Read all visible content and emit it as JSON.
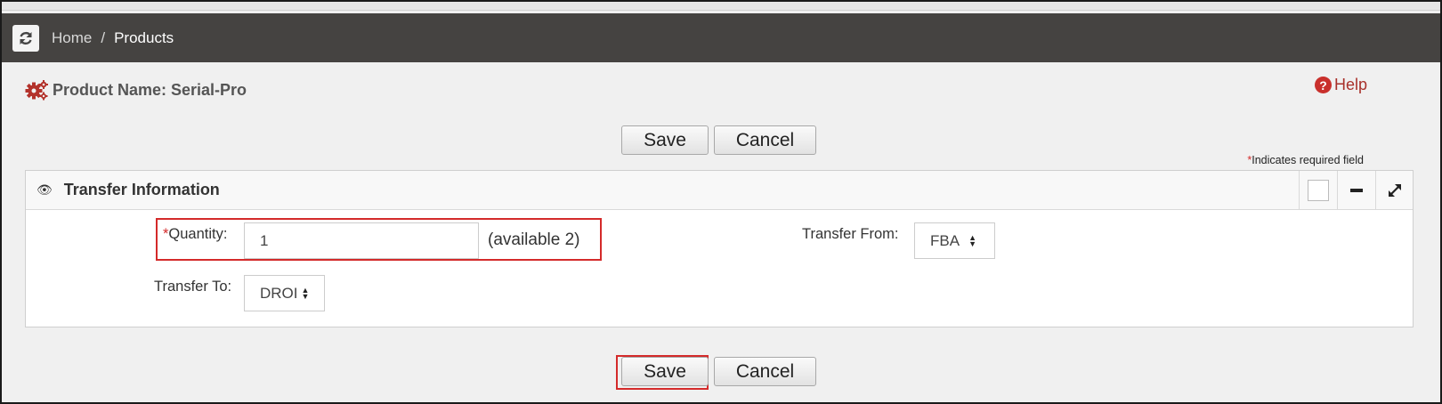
{
  "breadcrumb": {
    "home": "Home",
    "separator": "/",
    "current": "Products"
  },
  "page": {
    "title": "Product Name: Serial-Pro",
    "help": "Help"
  },
  "actions": {
    "save": "Save",
    "cancel": "Cancel"
  },
  "required_note": {
    "star": "*",
    "text": "Indicates required field"
  },
  "panel": {
    "title": "Transfer Information",
    "quantity_label": "Quantity:",
    "quantity_value": "1",
    "available_text": "(available  2)",
    "transfer_from_label": "Transfer From:",
    "transfer_from_value": "FBA",
    "transfer_to_label": "Transfer To:",
    "transfer_to_value": "DROI"
  },
  "icons": [
    "refresh-icon",
    "gears-icon",
    "help-icon",
    "eye-icon",
    "checkbox-icon",
    "minimize-icon",
    "expand-icon",
    "select-arrows-icon"
  ],
  "colors": {
    "topbar": "#454341",
    "highlight": "#d42a2a",
    "help": "#a8302a",
    "gear": "#b3322b"
  }
}
